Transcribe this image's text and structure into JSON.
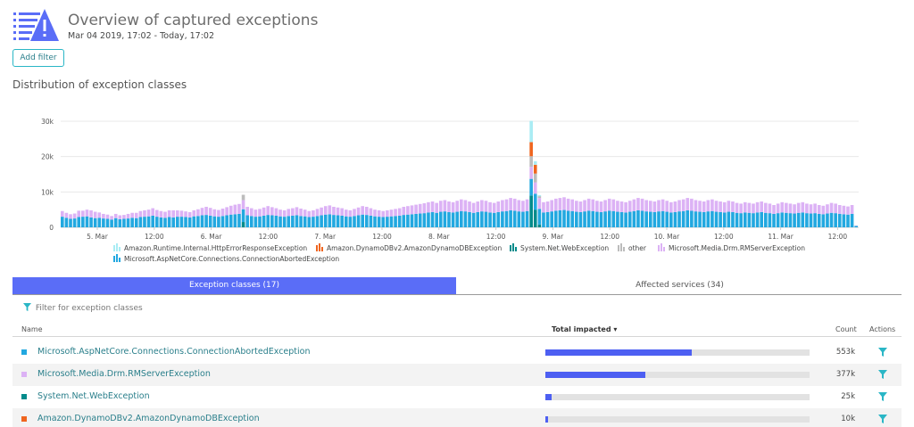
{
  "header": {
    "title": "Overview of captured exceptions",
    "timeframe": "Mar 04 2019, 17:02 - Today, 17:02",
    "logo_icon": "exception-warning-logo-icon"
  },
  "add_filter_label": "Add filter",
  "section_title": "Distribution of exception classes",
  "colors": {
    "runtime_http": "#a9ecf4",
    "dynamodb": "#ef651f",
    "system_net": "#008b8b",
    "other": "#bcbcbc",
    "drm": "#dcb2f5",
    "aspnet": "#22a8e0",
    "accent": "#5a6df7",
    "link": "#2a7f8b",
    "bar": "#4d5ff2"
  },
  "chart_data": {
    "type": "bar",
    "stacked": true,
    "y_ticks": [
      "0",
      "10k",
      "20k",
      "30k"
    ],
    "ylim": [
      0,
      30000
    ],
    "x_ticks": [
      "5. Mar",
      "12:00",
      "6. Mar",
      "12:00",
      "7. Mar",
      "12:00",
      "8. Mar",
      "12:00",
      "9. Mar",
      "12:00",
      "10. Mar",
      "12:00",
      "11. Mar",
      "12:00"
    ],
    "grid": true,
    "legend_position": "bottom",
    "series": [
      {
        "name": "Amazon.Runtime.Internal.HttpErrorResponseException",
        "color": "#a9ecf4"
      },
      {
        "name": "Amazon.DynamoDBv2.AmazonDynamoDBException",
        "color": "#ef651f"
      },
      {
        "name": "System.Net.WebException",
        "color": "#008b8b"
      },
      {
        "name": "other",
        "color": "#bcbcbc"
      },
      {
        "name": "Microsoft.Media.Drm.RMServerException",
        "color": "#dcb2f5"
      },
      {
        "name": "Microsoft.AspNetCore.Connections.ConnectionAbortedException",
        "color": "#22a8e0"
      }
    ],
    "aspnet_values": [
      3000,
      2700,
      2400,
      2500,
      2900,
      3000,
      3100,
      2800,
      2600,
      2700,
      2500,
      2400,
      2200,
      2600,
      2300,
      2400,
      2500,
      2700,
      2600,
      2900,
      3000,
      3100,
      3300,
      3000,
      2800,
      2700,
      2900,
      2800,
      3000,
      3000,
      2900,
      2800,
      3100,
      3200,
      3400,
      3500,
      3300,
      3100,
      3000,
      3200,
      3400,
      3600,
      3700,
      3800,
      3600,
      3400,
      3200,
      3000,
      3100,
      3300,
      3500,
      3400,
      3300,
      3100,
      3000,
      3200,
      3300,
      3400,
      3200,
      3100,
      2900,
      3000,
      3200,
      3400,
      3600,
      3700,
      3500,
      3400,
      3300,
      3100,
      3000,
      3200,
      3400,
      3600,
      3500,
      3300,
      3100,
      3000,
      2900,
      3000,
      3100,
      3200,
      3300,
      3500,
      3600,
      3700,
      3800,
      3900,
      4000,
      4200,
      4300,
      4100,
      4400,
      4500,
      4300,
      4200,
      4400,
      4600,
      4500,
      4300,
      4100,
      4300,
      4500,
      4400,
      4200,
      4100,
      4300,
      4500,
      4600,
      4800,
      4700,
      4500,
      4400,
      4600,
      4700,
      4500,
      4400,
      4200,
      4300,
      4500,
      4700,
      4800,
      4900,
      4700,
      4600,
      4400,
      4300,
      4500,
      4700,
      4600,
      4400,
      4300,
      4500,
      4700,
      4600,
      4400,
      4300,
      4200,
      4400,
      4600,
      4800,
      4700,
      4500,
      4400,
      4300,
      4500,
      4600,
      4400,
      4200,
      4300,
      4500,
      4600,
      4800,
      4700,
      4500,
      4400,
      4300,
      4500,
      4600,
      4400,
      4300,
      4200,
      4400,
      4300,
      4100,
      4000,
      4200,
      4100,
      4000,
      4200,
      4300,
      4100,
      4000,
      3800,
      4000,
      4200,
      4100,
      4000,
      3900,
      4100,
      4200,
      4000,
      3900,
      4000,
      3800,
      3700,
      3900,
      4100,
      4000,
      3800,
      3700,
      3600,
      3800,
      400
    ],
    "drm_values": [
      1600,
      1400,
      1300,
      1400,
      1800,
      1700,
      1900,
      2000,
      1800,
      1500,
      1300,
      1200,
      1000,
      1200,
      1100,
      1100,
      1300,
      1400,
      1500,
      1700,
      1800,
      1900,
      2100,
      1900,
      1800,
      1700,
      1900,
      2000,
      1800,
      1700,
      1600,
      1500,
      1700,
      1900,
      2100,
      2300,
      2200,
      2000,
      1900,
      2100,
      2300,
      2500,
      2700,
      2800,
      2600,
      2400,
      2200,
      2000,
      2100,
      2300,
      2500,
      2300,
      2100,
      1900,
      1800,
      2000,
      2100,
      2300,
      2100,
      1900,
      1700,
      1800,
      2000,
      2200,
      2400,
      2500,
      2300,
      2200,
      2100,
      1900,
      1800,
      2000,
      2200,
      2400,
      2300,
      2100,
      1900,
      1800,
      1700,
      1800,
      1900,
      2000,
      2100,
      2300,
      2400,
      2500,
      2600,
      2700,
      2800,
      2900,
      3000,
      2800,
      3100,
      3200,
      3000,
      2900,
      3100,
      3300,
      3200,
      3000,
      2800,
      3000,
      3200,
      3100,
      2900,
      2800,
      3000,
      3200,
      3300,
      3500,
      3400,
      3200,
      3100,
      3300,
      3400,
      3200,
      3100,
      2900,
      3000,
      3200,
      3400,
      3500,
      3600,
      3400,
      3300,
      3100,
      3000,
      3200,
      3400,
      3300,
      3100,
      3000,
      3200,
      3400,
      3300,
      3100,
      3000,
      2900,
      3100,
      3300,
      3500,
      3400,
      3200,
      3100,
      3000,
      3200,
      3300,
      3100,
      2900,
      3000,
      3200,
      3300,
      3500,
      3400,
      3200,
      3100,
      3000,
      3200,
      3300,
      3100,
      3000,
      2900,
      3100,
      3000,
      2800,
      2700,
      2900,
      2800,
      2700,
      2900,
      3000,
      2800,
      2700,
      2500,
      2700,
      2900,
      2800,
      2700,
      2600,
      2800,
      2900,
      2700,
      2600,
      2700,
      2500,
      2400,
      2600,
      2800,
      2700,
      2500,
      2400,
      2300,
      2500,
      100
    ],
    "spikes": [
      {
        "index": 44,
        "system_net": 1500,
        "other": 1500,
        "dynamodb": 0,
        "runtime_http": 0
      },
      {
        "index": 114,
        "system_net": 9000,
        "other": 3000,
        "dynamodb": 4000,
        "runtime_http": 6000
      },
      {
        "index": 115,
        "system_net": 5000,
        "other": 2500,
        "dynamodb": 2500,
        "runtime_http": 1000
      },
      {
        "index": 116,
        "system_net": 800,
        "other": 500,
        "dynamodb": 0,
        "runtime_http": 300
      }
    ]
  },
  "tabs": [
    {
      "label": "Exception classes (17)"
    },
    {
      "label": "Affected services (34)"
    }
  ],
  "filter_placeholder": "Filter for exception classes",
  "table": {
    "columns": {
      "name": "Name",
      "total": "Total impacted",
      "count": "Count",
      "actions": "Actions"
    },
    "rows": [
      {
        "name": "Microsoft.AspNetCore.Connections.ConnectionAbortedException",
        "color": "#22a8e0",
        "fraction": 0.553,
        "count": "553k"
      },
      {
        "name": "Microsoft.Media.Drm.RMServerException",
        "color": "#dcb2f5",
        "fraction": 0.377,
        "count": "377k"
      },
      {
        "name": "System.Net.WebException",
        "color": "#008b8b",
        "fraction": 0.025,
        "count": "25k"
      },
      {
        "name": "Amazon.DynamoDBv2.AmazonDynamoDBException",
        "color": "#ef651f",
        "fraction": 0.01,
        "count": "10k"
      }
    ]
  }
}
